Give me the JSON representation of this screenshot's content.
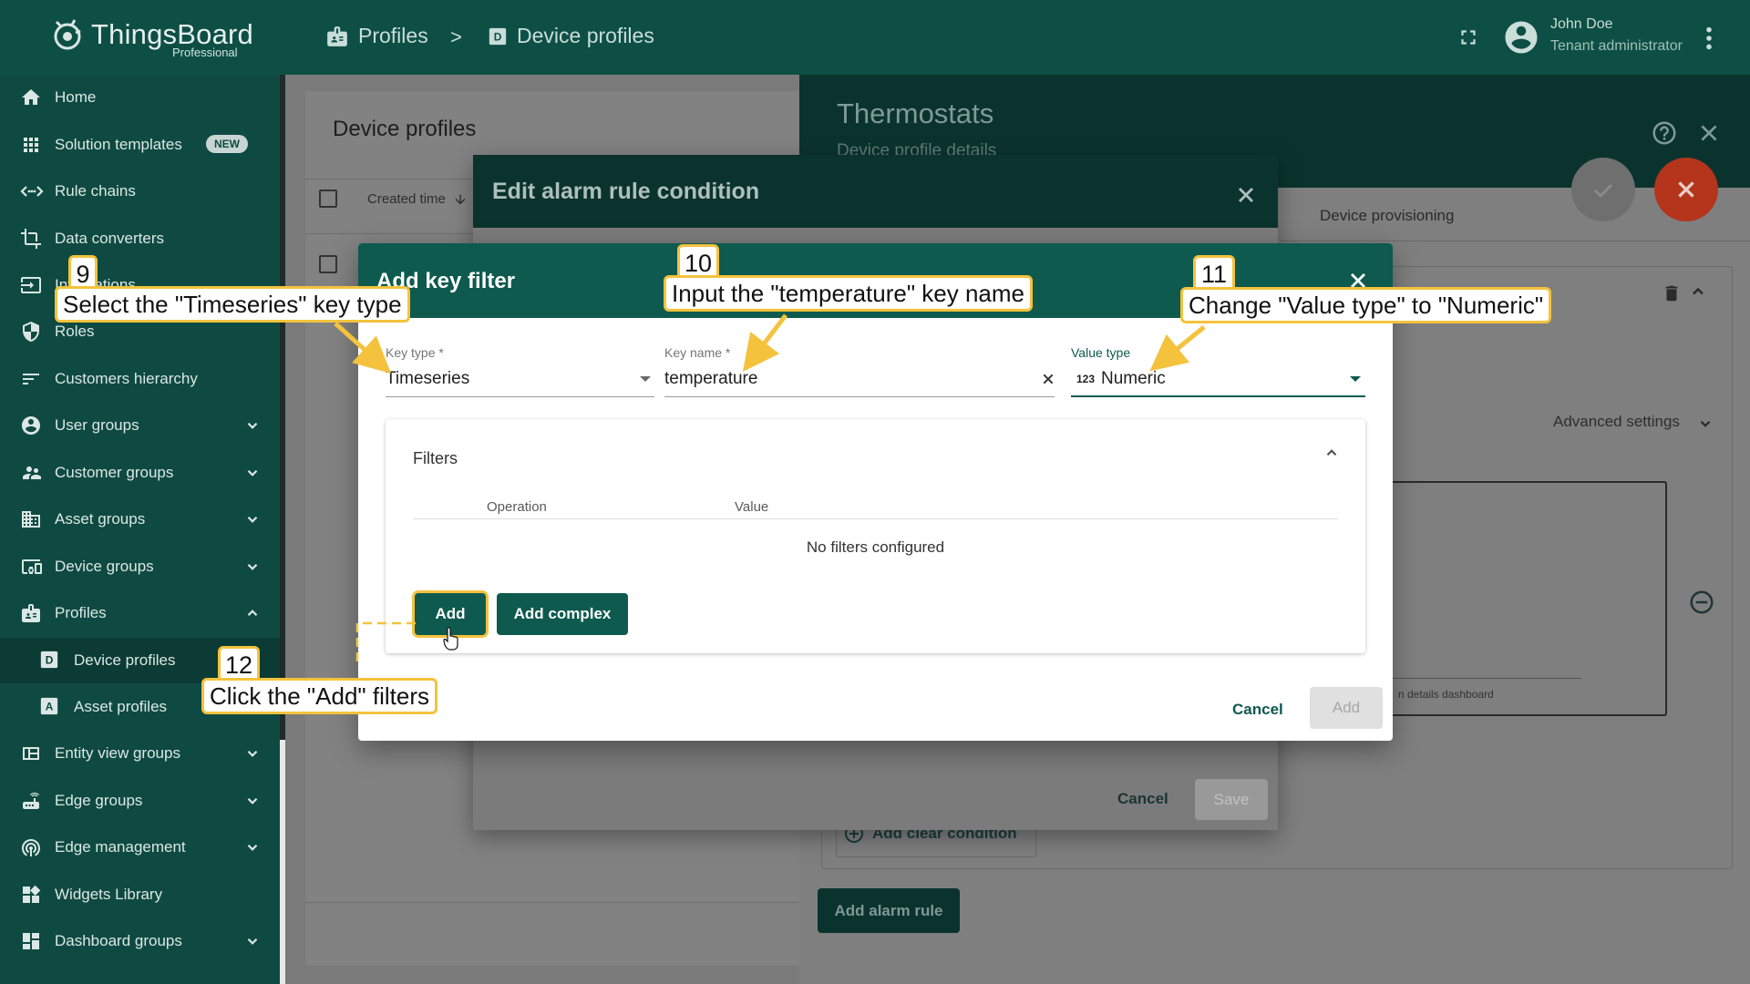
{
  "topbar": {
    "brand": "ThingsBoard",
    "edition": "Professional",
    "crumbs": [
      "Profiles",
      "Device profiles"
    ],
    "separator": ">",
    "user_name": "John Doe",
    "user_role": "Tenant administrator"
  },
  "sidebar": {
    "items": [
      {
        "label": "Home",
        "icon": "home-icon"
      },
      {
        "label": "Solution templates",
        "icon": "grid-icon",
        "badge": "NEW"
      },
      {
        "label": "Rule chains",
        "icon": "code-arrows-icon"
      },
      {
        "label": "Data converters",
        "icon": "crop-icon"
      },
      {
        "label": "Integrations",
        "icon": "input-icon"
      },
      {
        "label": "Roles",
        "icon": "shield-icon"
      },
      {
        "label": "Customers hierarchy",
        "icon": "sort-lines-icon"
      },
      {
        "label": "User groups",
        "icon": "account-circle-icon"
      },
      {
        "label": "Customer groups",
        "icon": "supervisor-icon"
      },
      {
        "label": "Asset groups",
        "icon": "domain-icon"
      },
      {
        "label": "Device groups",
        "icon": "devices-icon"
      },
      {
        "label": "Profiles",
        "icon": "badge-icon"
      },
      {
        "label": "Device profiles",
        "icon": "device-profile-icon"
      },
      {
        "label": "Asset profiles",
        "icon": "asset-profile-icon"
      },
      {
        "label": "Entity view groups",
        "icon": "view-quilt-icon"
      },
      {
        "label": "Edge groups",
        "icon": "router-icon"
      },
      {
        "label": "Edge management",
        "icon": "wifi-tethering-icon"
      },
      {
        "label": "Widgets Library",
        "icon": "widgets-icon"
      },
      {
        "label": "Dashboard groups",
        "icon": "dashboard-icon"
      }
    ]
  },
  "list_panel": {
    "title": "Device profiles",
    "col_created": "Created time"
  },
  "details": {
    "title": "Thermostats",
    "subtitle": "Device profile details",
    "tab_provisioning": "Device provisioning",
    "advanced_settings": "Advanced settings",
    "dashboard_hint": "n details dashboard",
    "add_clear_condition": "Add clear condition",
    "add_alarm_rule": "Add alarm rule"
  },
  "outer_dialog": {
    "title": "Edit alarm rule condition",
    "cancel": "Cancel",
    "save": "Save"
  },
  "key_filter": {
    "title": "Add key filter",
    "key_type_label": "Key type *",
    "key_type_value": "Timeseries",
    "key_name_label": "Key name *",
    "key_name_value": "temperature",
    "value_type_label": "Value type",
    "value_type_icon_text": "123",
    "value_type_value": "Numeric",
    "filters_title": "Filters",
    "col_operation": "Operation",
    "col_value": "Value",
    "no_filters": "No filters configured",
    "add_button": "Add",
    "add_complex_button": "Add complex",
    "cancel": "Cancel",
    "add_disabled": "Add"
  },
  "annotations": [
    {
      "num": "9",
      "text": "Select the \"Timeseries\" key type"
    },
    {
      "num": "10",
      "text": "Input the \"temperature\" key name"
    },
    {
      "num": "11",
      "text": "Change \"Value type\" to \"Numeric\""
    },
    {
      "num": "12",
      "text": "Click the \"Add\" filters"
    }
  ],
  "colors": {
    "primary": "#0e5a4e",
    "sidebar": "#0f4a42",
    "annotation": "#f4c23d",
    "fab_close": "#b4351c"
  }
}
